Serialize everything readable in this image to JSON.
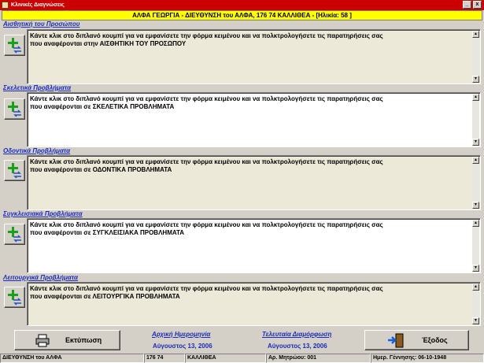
{
  "window": {
    "title": "Κλινικές Διαγνώσεις",
    "minimize_symbol": "_",
    "close_symbol": "x"
  },
  "header": {
    "patient_info": "ΑΛΦΑ ΓΕΩΡΓΙΑ - ΔΙΕΥΘΥΝΣΗ του ΑΛΦΑ, 176 74 ΚΑΛΛΙΘΕΑ - [Ηλικία: 58 ]"
  },
  "sections": [
    {
      "label": "Αισθητική του Προσώπου",
      "text": "Κάντε κλικ στο διπλανό κουμπί για να εμφανίσετε την φόρμα κειμένου και να πολκτρολογήσετε τις παρατηρήσεις σας\nπου αναφέρονται στην ΑΙΣΘΗΤΙΚΗ ΤΟΥ ΠΡΟΣΩΠΟΥ"
    },
    {
      "label": "Σκελετικά Προβλήματα",
      "text": "Κάντε κλικ στο διπλανό κουμπί για να εμφανίσετε την φόρμα κειμένου και να πολκτρολογήσετε τις παρατηρήσεις σας\nπου αναφέρονται σε ΣΚΕΛΕΤΙΚΑ ΠΡΟΒΛΗΜΑΤΑ"
    },
    {
      "label": "Οδοντικά Προβλήματα",
      "text": "Κάντε κλικ στο διπλανό κουμπί για να εμφανίσετε την φόρμα κειμένου και να πολκτρολογήσετε τις παρατηρήσεις σας\nπου αναφέρονται σε ΟΔΟΝΤΙΚΑ ΠΡΟΒΛΗΜΑΤΑ"
    },
    {
      "label": "Συγκλεισιακά Προβλήματα",
      "text": "Κάντε κλικ στο διπλανό κουμπί για να εμφανίσετε την φόρμα κειμένου και να πολκτρολογήσετε τις παρατηρήσεις σας\nπου αναφέρονται σε ΣΥΓΚΛΕΙΣΙΑΚΑ ΠΡΟΒΛΗΜΑΤΑ"
    },
    {
      "label": "Λειτουργικά Προβλήματα",
      "text": "Κάντε κλικ στο διπλανό κουμπί για να εμφανίσετε την φόρμα κειμένου και να πολκτρολογήσετε τις παρατηρήσεις σας\nπου αναφέρονται σε ΛΕΙΤΟΥΡΓΙΚΑ ΠΡΟΒΛΗΜΑΤΑ"
    }
  ],
  "footer": {
    "print_label": "Εκτύπωση",
    "initial_date_title": "Αρχική Ημερομηνία",
    "initial_date": "Αύγουστος 13, 2006",
    "last_modified_title": "Τελευταία Διαμόρφωση",
    "last_modified_date": "Αύγουστος 13, 2006",
    "exit_label": "Έξοδος"
  },
  "statusbar": {
    "address": "ΔΙΕΥΘΥΝΣΗ του ΑΛΦΑ",
    "postal_code": "176 74",
    "city": "ΚΑΛΛΙΘΕΑ",
    "registry_number": "Αρ. Μητρώου: 001",
    "birth_date": "Ημερ. Γέννησης: 06-10-1948"
  },
  "colors": {
    "title_bar": "#cc0000",
    "header_bg": "#ffff00",
    "label_blue": "#1a2bb8",
    "beige_field": "#ece9d8"
  }
}
